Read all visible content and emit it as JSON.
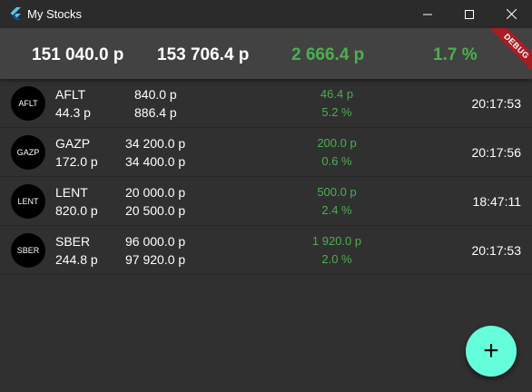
{
  "window": {
    "title": "My Stocks",
    "icon": "flutter-icon"
  },
  "summary": {
    "total_price": "151 040.0 р",
    "total_value": "153 706.4 р",
    "total_change": "2 666.4 р",
    "total_change_pct": "1.7 %",
    "debug_banner": "DEBUG"
  },
  "colors": {
    "background": "#303030",
    "header": "#424242",
    "positive": "#4caf50",
    "fab": "#64ffda",
    "debug": "#a81d24"
  },
  "stocks": [
    {
      "avatar": "AFLT",
      "ticker": "AFLT",
      "last_price": "44.3 р",
      "price": "840.0 р",
      "total": "886.4 р",
      "change": "46.4 р",
      "change_pct": "5.2 %",
      "time": "20:17:53"
    },
    {
      "avatar": "GAZP",
      "ticker": "GAZP",
      "last_price": "172.0 р",
      "price": "34 200.0 р",
      "total": "34 400.0 р",
      "change": "200.0 р",
      "change_pct": "0.6 %",
      "time": "20:17:56"
    },
    {
      "avatar": "LENT",
      "ticker": "LENT",
      "last_price": "820.0 р",
      "price": "20 000.0 р",
      "total": "20 500.0 р",
      "change": "500.0 р",
      "change_pct": "2.4 %",
      "time": "18:47:11"
    },
    {
      "avatar": "SBER",
      "ticker": "SBER",
      "last_price": "244.8 р",
      "price": "96 000.0 р",
      "total": "97 920.0 р",
      "change": "1 920.0 р",
      "change_pct": "2.0 %",
      "time": "20:17:53"
    }
  ],
  "fab": {
    "label": "+",
    "icon": "add-icon"
  }
}
